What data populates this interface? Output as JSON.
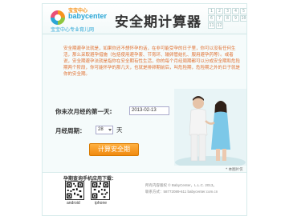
{
  "logo": {
    "cn": "宝宝中心",
    "en": "babycenter",
    "tagline": "宝宝中心专业育儿网"
  },
  "header": {
    "title": "安全期计算器"
  },
  "intro": {
    "text": "安全期避孕法就是，如果你还不想怀孕的话，在非可能受孕的日子里，你可以没有任何生活，那么采取避孕措施（包括使用避孕套、节育环、输卵管结扎、服用避孕药等）。或者说，安全期避孕法就是指你在安全期有性生活，你的每个月经周期都可以分成安全期和危险期两个阶段，你可能怀孕的那几天，也就是排卵期前后，叫危险期，危险期之外的日子就是你的安全期。"
  },
  "form": {
    "last_period_label": "你未次月经的第一天:",
    "last_period_value": "2013-02-13",
    "cycle_label": "月经周期：",
    "cycle_value": "28",
    "cycle_unit": "天",
    "calc_button": "计算安全期"
  },
  "illustration": {
    "caption": "* 本图片仅供参考"
  },
  "footer": {
    "app_heading": "孕期查询手机应用下载：",
    "qr_android_label": "android",
    "qr_iphone_label": "iphone",
    "copyright_line1": "所有内容版权 © BabyCenter，L.L.C. 2013。",
    "copyright_line2": "联系方式：58772089-611 babycenter.com.cn"
  },
  "calendar_deco": [
    "1",
    "2",
    "3",
    "4",
    "5",
    "6",
    "7",
    "8",
    "9",
    "10",
    "11",
    "12"
  ],
  "colors": {
    "accent": "#2aa6d6",
    "button": "#f08a10",
    "intro_text": "#e07030"
  },
  "icons": {
    "logo": "babycenter-swirl-icon",
    "select_chevron": "chevron-down-icon"
  }
}
